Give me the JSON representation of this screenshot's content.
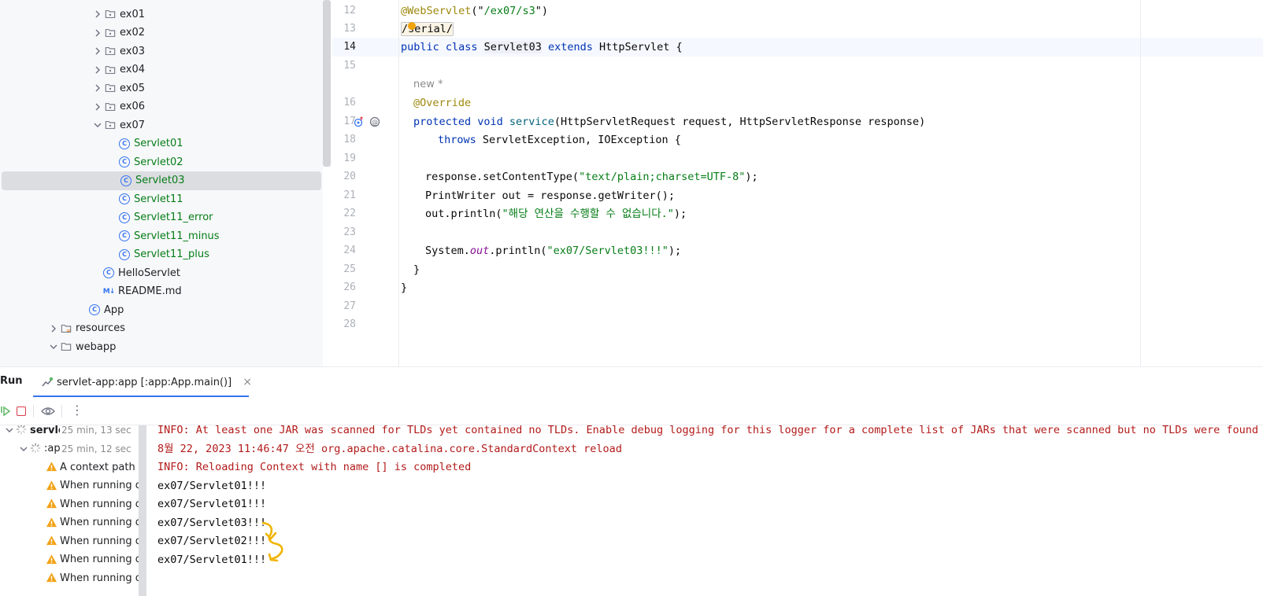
{
  "project_tree": {
    "items": [
      {
        "label": "ex01",
        "depth": 3,
        "type": "folder",
        "expanded": false
      },
      {
        "label": "ex02",
        "depth": 3,
        "type": "folder",
        "expanded": false
      },
      {
        "label": "ex03",
        "depth": 3,
        "type": "folder",
        "expanded": false
      },
      {
        "label": "ex04",
        "depth": 3,
        "type": "folder",
        "expanded": false
      },
      {
        "label": "ex05",
        "depth": 3,
        "type": "folder",
        "expanded": false
      },
      {
        "label": "ex06",
        "depth": 3,
        "type": "folder",
        "expanded": false
      },
      {
        "label": "ex07",
        "depth": 3,
        "type": "folder",
        "expanded": true
      },
      {
        "label": "Servlet01",
        "depth": 4,
        "type": "class",
        "modified": true
      },
      {
        "label": "Servlet02",
        "depth": 4,
        "type": "class",
        "modified": true
      },
      {
        "label": "Servlet03",
        "depth": 4,
        "type": "class",
        "modified": true,
        "selected": true
      },
      {
        "label": "Servlet11",
        "depth": 4,
        "type": "class",
        "modified": true
      },
      {
        "label": "Servlet11_error",
        "depth": 4,
        "type": "class",
        "modified": true
      },
      {
        "label": "Servlet11_minus",
        "depth": 4,
        "type": "class",
        "modified": true
      },
      {
        "label": "Servlet11_plus",
        "depth": 4,
        "type": "class",
        "modified": true
      },
      {
        "label": "HelloServlet",
        "depth": 3,
        "type": "class"
      },
      {
        "label": "README.md",
        "depth": 3,
        "type": "markdown"
      },
      {
        "label": "App",
        "depth": 2,
        "type": "class"
      },
      {
        "label": "resources",
        "depth": 1,
        "type": "resfolder",
        "expanded": false
      },
      {
        "label": "webapp",
        "depth": 1,
        "type": "folder",
        "expanded": true
      }
    ]
  },
  "editor": {
    "hint": "new *",
    "lines": [
      {
        "n": "12",
        "parts": [
          [
            "an",
            "@WebServlet"
          ],
          [
            "",
            "(\""
          ],
          [
            "st",
            "/ex07/s3"
          ],
          [
            "",
            "\")"
          ]
        ]
      },
      {
        "n": "13",
        "parts": [
          [
            "box",
            "/serial/"
          ]
        ]
      },
      {
        "n": "14",
        "current": true,
        "parts": [
          [
            "kw",
            "public class "
          ],
          [
            "sel",
            "Servlet03"
          ],
          [
            "kw",
            " extends "
          ],
          [
            "",
            "HttpServlet {"
          ]
        ]
      },
      {
        "n": "15",
        "parts": []
      },
      {
        "n": "16",
        "indent": 1,
        "parts": [
          [
            "an",
            "@Override"
          ]
        ]
      },
      {
        "n": "17",
        "indent": 1,
        "icons": true,
        "parts": [
          [
            "kw",
            "protected void "
          ],
          [
            "fn",
            "service"
          ],
          [
            "",
            "(HttpServletRequest request, HttpServletResponse response)"
          ]
        ]
      },
      {
        "n": "18",
        "indent": 3,
        "parts": [
          [
            "kw",
            "throws "
          ],
          [
            "",
            "ServletException, IOException {"
          ]
        ]
      },
      {
        "n": "19",
        "parts": []
      },
      {
        "n": "20",
        "indent": 2,
        "parts": [
          [
            "",
            "response.setContentType("
          ],
          [
            "st",
            "\"text/plain;charset=UTF-8\""
          ],
          [
            "",
            ");"
          ]
        ]
      },
      {
        "n": "21",
        "indent": 2,
        "parts": [
          [
            "",
            "PrintWriter out = response.getWriter();"
          ]
        ]
      },
      {
        "n": "22",
        "indent": 2,
        "parts": [
          [
            "",
            "out.println("
          ],
          [
            "st",
            "\"해당 연산을 수행할 수 없습니다.\""
          ],
          [
            "",
            ");"
          ]
        ]
      },
      {
        "n": "23",
        "parts": []
      },
      {
        "n": "24",
        "indent": 2,
        "parts": [
          [
            "",
            "System."
          ],
          [
            "it",
            "out"
          ],
          [
            "",
            ".println("
          ],
          [
            "st",
            "\"ex07/Servlet03!!!\""
          ],
          [
            "",
            ");"
          ]
        ]
      },
      {
        "n": "25",
        "indent": 1,
        "parts": [
          [
            "",
            "}"
          ]
        ]
      },
      {
        "n": "26",
        "parts": [
          [
            "",
            "}"
          ]
        ]
      },
      {
        "n": "27",
        "parts": []
      },
      {
        "n": "28",
        "parts": []
      }
    ]
  },
  "run_panel": {
    "title": "Run",
    "tab_label": "servlet-app:app [:app:App.main()]",
    "tree": [
      {
        "label": "servle",
        "time": "25 min, 13 sec",
        "depth": 0,
        "kind": "spinner",
        "bold": true
      },
      {
        "label": ":ap",
        "time": "25 min, 12 sec",
        "depth": 1,
        "kind": "spinner"
      },
      {
        "label": "A context path m",
        "depth": 2,
        "kind": "warning"
      },
      {
        "label": "When running on",
        "depth": 2,
        "kind": "warning"
      },
      {
        "label": "When running on",
        "depth": 2,
        "kind": "warning"
      },
      {
        "label": "When running on",
        "depth": 2,
        "kind": "warning"
      },
      {
        "label": "When running on",
        "depth": 2,
        "kind": "warning"
      },
      {
        "label": "When running on",
        "depth": 2,
        "kind": "warning"
      },
      {
        "label": "When running on",
        "depth": 2,
        "kind": "warning"
      }
    ],
    "console": [
      {
        "text": "INFO: At least one JAR was scanned for TLDs yet contained no TLDs. Enable debug logging for this logger for a complete list of JARs that were scanned but no TLDs were found in",
        "kind": "err"
      },
      {
        "text": "8월 22, 2023 11:46:47 오전 org.apache.catalina.core.StandardContext reload",
        "kind": "err"
      },
      {
        "text": "INFO: Reloading Context with name [] is completed",
        "kind": "err"
      },
      {
        "text": "ex07/Servlet01!!!",
        "kind": "out"
      },
      {
        "text": "ex07/Servlet01!!!",
        "kind": "out"
      },
      {
        "text": "ex07/Servlet03!!!",
        "kind": "out"
      },
      {
        "text": "ex07/Servlet02!!!",
        "kind": "out"
      },
      {
        "text": "ex07/Servlet01!!!",
        "kind": "out"
      }
    ]
  },
  "colors": {
    "accent": "#3574f0",
    "modified_file": "#067d17",
    "console_error": "#b31a1a",
    "annotation_mark": "#f0b400"
  }
}
